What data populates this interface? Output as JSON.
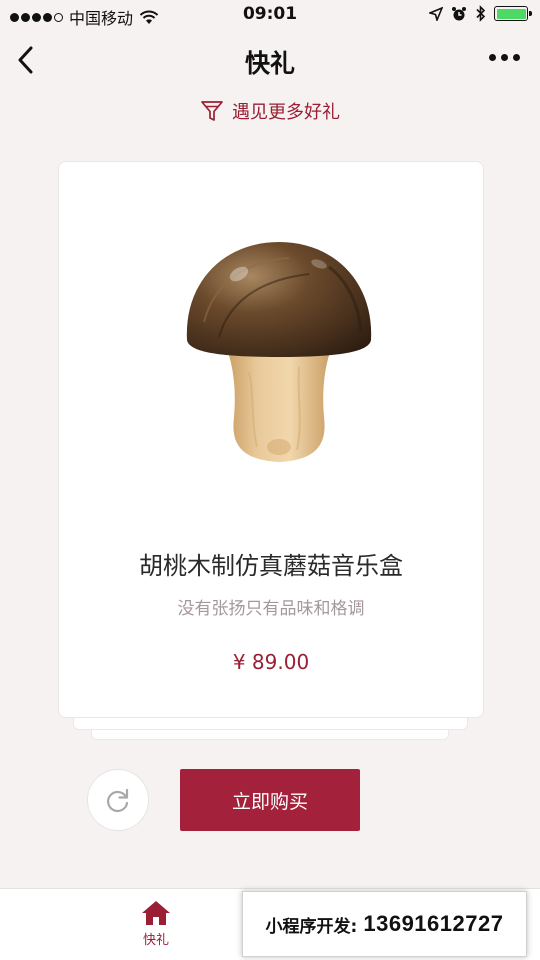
{
  "status_bar": {
    "carrier": "中国移动",
    "time": "09:01",
    "battery_color": "#4cd964"
  },
  "nav": {
    "title": "快礼",
    "back_icon": "chevron-left-icon",
    "more_icon": "more-dots-icon"
  },
  "filter": {
    "label": "遇见更多好礼",
    "icon": "funnel-icon"
  },
  "product": {
    "name": "胡桃木制仿真蘑菇音乐盒",
    "description": "没有张扬只有品味和格调",
    "price": "¥ 89.00",
    "image": "mushroom-music-box"
  },
  "actions": {
    "refresh_icon": "refresh-icon",
    "buy_label": "立即购买"
  },
  "tabbar": {
    "items": [
      {
        "label": "快礼",
        "icon": "home-icon",
        "active": true
      }
    ]
  },
  "promo": {
    "label": "小程序开发:",
    "phone": "13691612727"
  },
  "colors": {
    "accent": "#9b1f34",
    "button": "#a3213a",
    "background": "#f5f2f1"
  }
}
